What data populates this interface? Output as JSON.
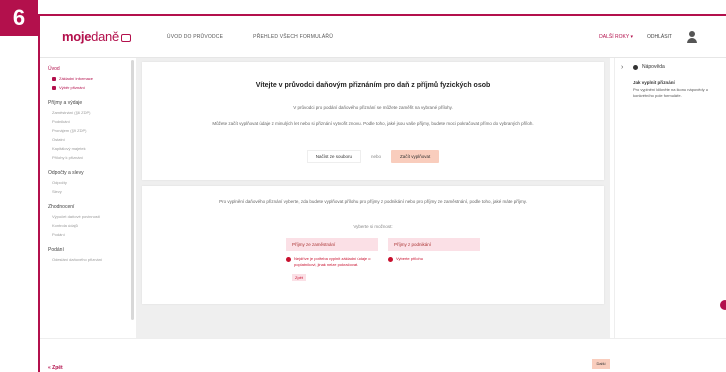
{
  "step_number": "6",
  "header": {
    "logo_main": "moje",
    "logo_thin": "daně",
    "nav": [
      "Úvod do průvodce",
      "Přehled všech formulářů"
    ],
    "more_years": "Další roky ▾",
    "login": "Odhlásit"
  },
  "sidebar": {
    "sections": [
      {
        "title": "Úvod",
        "items": [
          "Základní informace",
          "Výběr přiznání"
        ]
      },
      {
        "title": "Příjmy a výdaje",
        "items": [
          "Zaměstnání (§6 ZDP)",
          "Podnikání",
          "Pronájem (§9 ZDP)",
          "Ostatní",
          "Kapitálový majetek",
          "Přílohy k přiznání"
        ]
      },
      {
        "title": "Odpočty a slevy",
        "items": [
          "Odpočty",
          "Slevy"
        ]
      },
      {
        "title": "Zhodnocení",
        "items": [
          "Výpočet daňové povinnosti",
          "Kontrola údajů",
          "Podání"
        ]
      },
      {
        "title": "Podání",
        "items": [
          "Odeslání daňového přiznání"
        ]
      }
    ]
  },
  "card1": {
    "title": "Vítejte v průvodci daňovým přiznáním pro daň z příjmů fyzických osob",
    "line1": "V průvodci pro podání daňového přiznání se můžete zaměřit na vybrané přílohy.",
    "line2": "Můžete začít vyplňovat údaje z minulých let nebo si přiznání vytvořit znovu. Podle toho, jaké jsou vaše příjmy, budete moci pokračovat přímo do vybraných příloh.",
    "btn_secondary": "Načíst ze souboru",
    "or": "nebo",
    "btn_primary": "Začít vyplňovat"
  },
  "card2": {
    "text": "Pro vyplnění daňového přiznání vyberte, zda budete vyplňovat přílohu pro příjmy z podnikání nebo pro příjmy ze zaměstnání, podle toho, jaké máte příjmy.",
    "choose_label": "Vyberte si možnost:",
    "choice_a": "Příjmy ze zaměstnání",
    "choice_b": "Příjmy z podnikání",
    "warn_a": "Nejdříve je potřeba vyplnit základní údaje o poplatníkovi, jinak nelze pokračovat.",
    "warn_a_tag": "Zpět",
    "warn_b": "Vyberte přílohu"
  },
  "help": {
    "head": "Nápověda",
    "title": "Jak vyplnit přiznání",
    "text": "Pro vyplnění klikněte na ikonu nápovědy u konkrétního pole formuláře."
  },
  "footer": {
    "back": "« Zpět",
    "next": "Další"
  }
}
